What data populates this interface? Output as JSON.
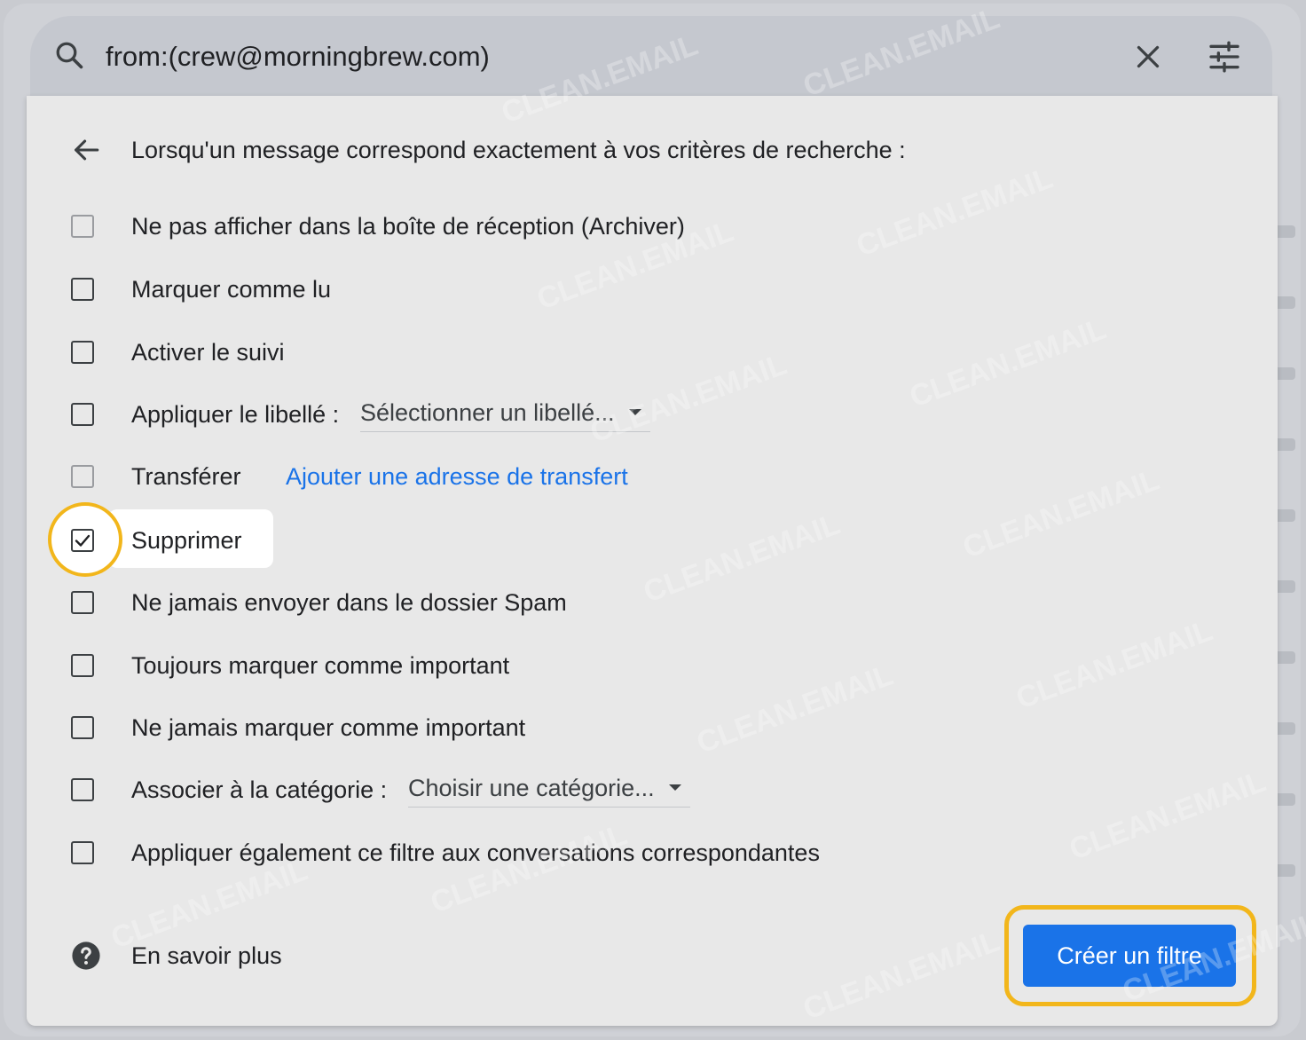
{
  "search": {
    "query": "from:(crew@morningbrew.com)"
  },
  "panel": {
    "heading": "Lorsqu'un message correspond exactement à vos critères de recherche :",
    "options": [
      {
        "label": "Ne pas afficher dans la boîte de réception (Archiver)",
        "checked": false
      },
      {
        "label": "Marquer comme lu",
        "checked": false
      },
      {
        "label": "Activer le suivi",
        "checked": false
      },
      {
        "label": "Appliquer le libellé :",
        "checked": false,
        "dropdown": "Sélectionner un libellé..."
      },
      {
        "label": "Transférer",
        "checked": false,
        "link": "Ajouter une adresse de transfert"
      },
      {
        "label": "Supprimer",
        "checked": true
      },
      {
        "label": "Ne jamais envoyer dans le dossier Spam",
        "checked": false
      },
      {
        "label": "Toujours marquer comme important",
        "checked": false
      },
      {
        "label": "Ne jamais marquer comme important",
        "checked": false
      },
      {
        "label": "Associer à la catégorie :",
        "checked": false,
        "dropdown": "Choisir une catégorie..."
      },
      {
        "label": "Appliquer également ce filtre aux conversations correspondantes",
        "checked": false
      }
    ],
    "help_label": "En savoir plus",
    "create_button": "Créer un filtre"
  },
  "watermark": "CLEAN.EMAIL",
  "colors": {
    "accent": "#1a73e8",
    "highlight": "#f2b61b"
  }
}
